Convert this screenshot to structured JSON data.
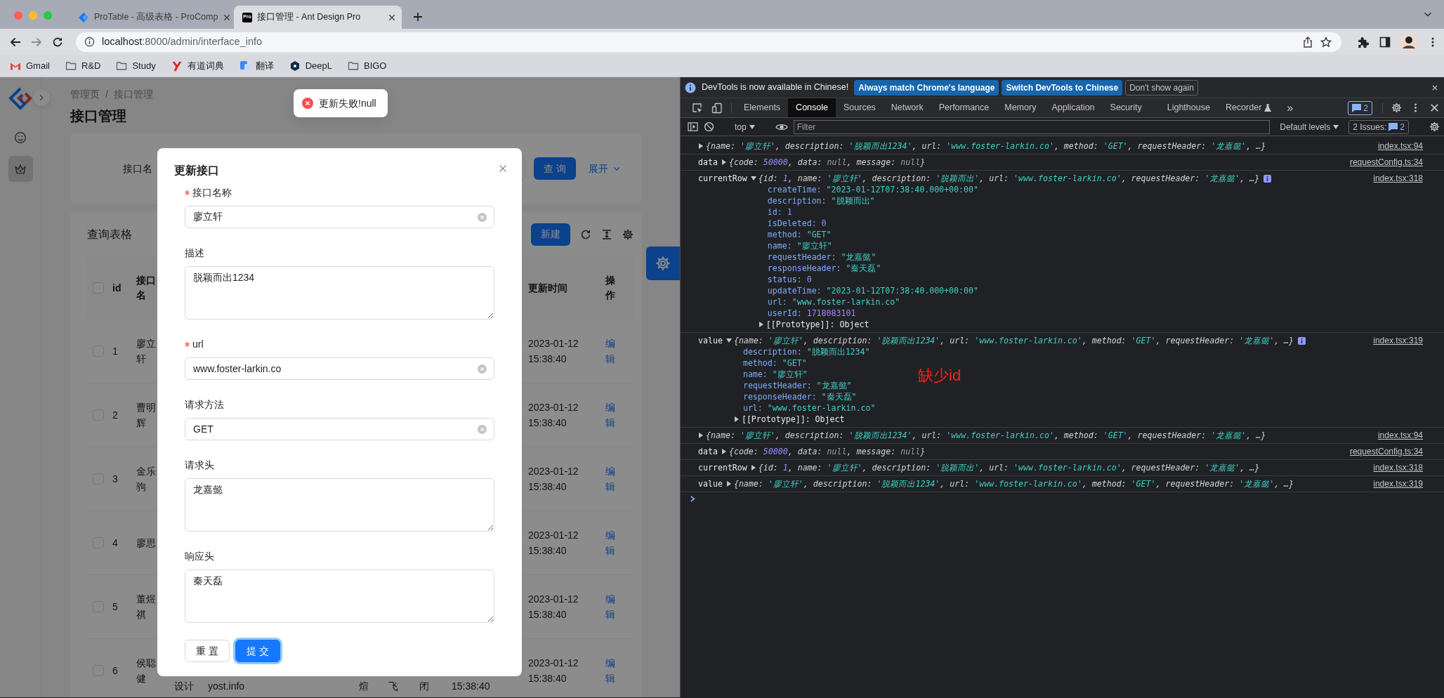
{
  "browser": {
    "tabs": [
      {
        "title": "ProTable - 高级表格 - ProComp",
        "icon": {
          "kind": "logo"
        },
        "selected": false
      },
      {
        "title": "接口管理 - Ant Design Pro",
        "icon": {
          "kind": "text",
          "text": "Pro"
        },
        "selected": true
      }
    ],
    "address": {
      "host": "localhost",
      "rest": ":8000/admin/interface_info"
    },
    "bookmarks": [
      {
        "label": "Gmail",
        "kind": "mail"
      },
      {
        "label": "R&D",
        "kind": "folder"
      },
      {
        "label": "Study",
        "kind": "folder"
      },
      {
        "label": "有道词典",
        "kind": "youdao"
      },
      {
        "label": "翻译",
        "kind": "translate"
      },
      {
        "label": "DeepL",
        "kind": "deepl"
      },
      {
        "label": "BIGO",
        "kind": "folder"
      }
    ]
  },
  "app": {
    "sidebar": {
      "items": [
        {
          "kind": "smile",
          "selected": false
        },
        {
          "kind": "crown",
          "selected": true
        }
      ]
    },
    "breadcrumb": {
      "items": [
        "管理页",
        "接口管理"
      ],
      "separator": "/"
    },
    "title": "接口管理",
    "search": {
      "label": "接口名",
      "button": "查 询",
      "expand": "展开"
    },
    "table": {
      "title": "查询表格",
      "new_button": "新建",
      "all_selected": false,
      "columns": [
        "id",
        "接口名",
        "更新时间",
        "操作"
      ],
      "rows": [
        {
          "selected": false,
          "id": "1",
          "name": "廖立轩",
          "updated": "2023-01-12 15:38:40",
          "action": "编辑"
        },
        {
          "selected": false,
          "id": "2",
          "name": "曹明辉",
          "updated": "2023-01-12 15:38:40",
          "action": "编辑"
        },
        {
          "selected": false,
          "id": "3",
          "name": "金乐驹",
          "updated": "2023-01-12 15:38:40",
          "action": "编辑"
        },
        {
          "selected": false,
          "id": "4",
          "name": "廖思",
          "updated": "2023-01-12 15:38:40",
          "action": "编辑"
        },
        {
          "selected": false,
          "id": "5",
          "name": "董煜祺",
          "updated": "2023-01-12 15:38:40",
          "action": "编辑"
        },
        {
          "selected": false,
          "id": "6",
          "name": "侯聪健",
          "updated": "2023-01-12 15:38:40",
          "action": "编辑",
          "tail": [
            "设计",
            "yost.info",
            "煊",
            "飞",
            "闭",
            "15:38:40"
          ]
        }
      ]
    },
    "toast": {
      "kind": "error",
      "text": "更新失败!null"
    },
    "modal": {
      "title": "更新接口",
      "fields": [
        {
          "label": "接口名称",
          "required": true,
          "kind": "input",
          "value": "廖立轩"
        },
        {
          "label": "描述",
          "required": false,
          "kind": "textarea",
          "value": "脱颖而出1234"
        },
        {
          "label": "url",
          "required": true,
          "kind": "input",
          "value": "www.foster-larkin.co"
        },
        {
          "label": "请求方法",
          "required": false,
          "kind": "input",
          "value": "GET"
        },
        {
          "label": "请求头",
          "required": false,
          "kind": "textarea",
          "value": "龙嘉懿"
        },
        {
          "label": "响应头",
          "required": false,
          "kind": "textarea",
          "value": "秦天磊"
        }
      ],
      "buttons": [
        {
          "label": "重 置",
          "primary": false,
          "focused": false
        },
        {
          "label": "提 交",
          "primary": true,
          "focused": true
        }
      ]
    }
  },
  "devtools": {
    "infobar": {
      "text": "DevTools is now available in Chinese!",
      "buttons": [
        {
          "label": "Always match Chrome's language",
          "primary": true
        },
        {
          "label": "Switch DevTools to Chinese",
          "primary": true
        },
        {
          "label": "Don't show again",
          "primary": false
        }
      ]
    },
    "tabs": [
      {
        "label": "Elements",
        "selected": false,
        "experimental": false
      },
      {
        "label": "Console",
        "selected": true,
        "experimental": false
      },
      {
        "label": "Sources",
        "selected": false,
        "experimental": false
      },
      {
        "label": "Network",
        "selected": false,
        "experimental": false
      },
      {
        "label": "Performance",
        "selected": false,
        "experimental": false
      },
      {
        "label": "Memory",
        "selected": false,
        "experimental": false
      },
      {
        "label": "Application",
        "selected": false,
        "experimental": false
      },
      {
        "label": "Security",
        "selected": false,
        "experimental": false
      },
      {
        "label": "Lighthouse",
        "selected": false,
        "experimental": false
      },
      {
        "label": "Recorder",
        "selected": false,
        "experimental": true
      }
    ],
    "overflow": "»",
    "messages_count": "2",
    "console_toolbar": {
      "context": "top",
      "filter_placeholder": "Filter",
      "levels": "Default levels",
      "issues_label": "2 Issues:",
      "issues_count": "2"
    },
    "entries": [
      {
        "expanded": false,
        "source": "index.tsx:94",
        "preview": [
          {
            "text": "{name: ",
            "kind": "key"
          },
          {
            "text": "'廖立轩'",
            "kind": "string"
          },
          {
            "text": ", description: ",
            "kind": "key"
          },
          {
            "text": "'脱颖而出1234'",
            "kind": "string"
          },
          {
            "text": ", url: ",
            "kind": "key"
          },
          {
            "text": "'www.foster-larkin.co'",
            "kind": "string"
          },
          {
            "text": ", method: ",
            "kind": "key"
          },
          {
            "text": "'GET'",
            "kind": "string"
          },
          {
            "text": ", requestHeader: ",
            "kind": "key"
          },
          {
            "text": "'龙嘉懿'",
            "kind": "string"
          },
          {
            "text": ", …}",
            "kind": "key"
          }
        ]
      },
      {
        "label": "data",
        "expanded": false,
        "source": "requestConfig.ts:34",
        "preview": [
          {
            "text": "{code: ",
            "kind": "key"
          },
          {
            "text": "50000",
            "kind": "number"
          },
          {
            "text": ", data: ",
            "kind": "key"
          },
          {
            "text": "null",
            "kind": "null"
          },
          {
            "text": ", message: ",
            "kind": "key"
          },
          {
            "text": "null",
            "kind": "null"
          },
          {
            "text": "}",
            "kind": "key"
          }
        ]
      },
      {
        "label": "currentRow",
        "expanded": true,
        "source": "index.tsx:318",
        "preview": [
          {
            "text": "{id: ",
            "kind": "key"
          },
          {
            "text": "1",
            "kind": "number"
          },
          {
            "text": ", name: ",
            "kind": "key"
          },
          {
            "text": "'廖立轩'",
            "kind": "string"
          },
          {
            "text": ", description: ",
            "kind": "key"
          },
          {
            "text": "'脱颖而出'",
            "kind": "string"
          },
          {
            "text": ", url: ",
            "kind": "key"
          },
          {
            "text": "'www.foster-larkin.co'",
            "kind": "string"
          },
          {
            "text": ", requestHeader: ",
            "kind": "key"
          },
          {
            "text": "'龙嘉懿'",
            "kind": "string"
          },
          {
            "text": ", …}",
            "kind": "key"
          }
        ],
        "props": [
          {
            "key": "createTime: ",
            "value": "\"2023-01-12T07:38:40.000+00:00\"",
            "kind": "string"
          },
          {
            "key": "description: ",
            "value": "\"脱颖而出\"",
            "kind": "string"
          },
          {
            "key": "id: ",
            "value": "1",
            "kind": "number"
          },
          {
            "key": "isDeleted: ",
            "value": "0",
            "kind": "number"
          },
          {
            "key": "method: ",
            "value": "\"GET\"",
            "kind": "string"
          },
          {
            "key": "name: ",
            "value": "\"廖立轩\"",
            "kind": "string"
          },
          {
            "key": "requestHeader: ",
            "value": "\"龙嘉懿\"",
            "kind": "string"
          },
          {
            "key": "responseHeader: ",
            "value": "\"秦天磊\"",
            "kind": "string"
          },
          {
            "key": "status: ",
            "value": "0",
            "kind": "number"
          },
          {
            "key": "updateTime: ",
            "value": "\"2023-01-12T07:38:40.000+00:00\"",
            "kind": "string"
          },
          {
            "key": "url: ",
            "value": "\"www.foster-larkin.co\"",
            "kind": "string"
          },
          {
            "key": "userId: ",
            "value": "1718083101",
            "kind": "number"
          },
          {
            "key": "[[Prototype]]: ",
            "value": "Object",
            "kind": "proto"
          }
        ]
      },
      {
        "label": "value",
        "expanded": true,
        "source": "index.tsx:319",
        "preview": [
          {
            "text": "{name: ",
            "kind": "key"
          },
          {
            "text": "'廖立轩'",
            "kind": "string"
          },
          {
            "text": ", description: ",
            "kind": "key"
          },
          {
            "text": "'脱颖而出1234'",
            "kind": "string"
          },
          {
            "text": ", url: ",
            "kind": "key"
          },
          {
            "text": "'www.foster-larkin.co'",
            "kind": "string"
          },
          {
            "text": ", method: ",
            "kind": "key"
          },
          {
            "text": "'GET'",
            "kind": "string"
          },
          {
            "text": ", requestHeader: ",
            "kind": "key"
          },
          {
            "text": "'龙嘉懿'",
            "kind": "string"
          },
          {
            "text": ", …}",
            "kind": "key"
          }
        ],
        "props": [
          {
            "key": "description: ",
            "value": "\"脱颖而出1234\"",
            "kind": "string"
          },
          {
            "key": "method: ",
            "value": "\"GET\"",
            "kind": "string"
          },
          {
            "key": "name: ",
            "value": "\"廖立轩\"",
            "kind": "string"
          },
          {
            "key": "requestHeader: ",
            "value": "\"龙嘉懿\"",
            "kind": "string"
          },
          {
            "key": "responseHeader: ",
            "value": "\"秦天磊\"",
            "kind": "string"
          },
          {
            "key": "url: ",
            "value": "\"www.foster-larkin.co\"",
            "kind": "string"
          },
          {
            "key": "[[Prototype]]: ",
            "value": "Object",
            "kind": "proto"
          }
        ]
      },
      {
        "expanded": false,
        "source": "index.tsx:94",
        "preview": [
          {
            "text": "{name: ",
            "kind": "key"
          },
          {
            "text": "'廖立轩'",
            "kind": "string"
          },
          {
            "text": ", description: ",
            "kind": "key"
          },
          {
            "text": "'脱颖而出1234'",
            "kind": "string"
          },
          {
            "text": ", url: ",
            "kind": "key"
          },
          {
            "text": "'www.foster-larkin.co'",
            "kind": "string"
          },
          {
            "text": ", method: ",
            "kind": "key"
          },
          {
            "text": "'GET'",
            "kind": "string"
          },
          {
            "text": ", requestHeader: ",
            "kind": "key"
          },
          {
            "text": "'龙嘉懿'",
            "kind": "string"
          },
          {
            "text": ", …}",
            "kind": "key"
          }
        ]
      },
      {
        "label": "data",
        "expanded": false,
        "source": "requestConfig.ts:34",
        "preview": [
          {
            "text": "{code: ",
            "kind": "key"
          },
          {
            "text": "50000",
            "kind": "number"
          },
          {
            "text": ", data: ",
            "kind": "key"
          },
          {
            "text": "null",
            "kind": "null"
          },
          {
            "text": ", message: ",
            "kind": "key"
          },
          {
            "text": "null",
            "kind": "null"
          },
          {
            "text": "}",
            "kind": "key"
          }
        ]
      },
      {
        "label": "currentRow",
        "expanded": false,
        "source": "index.tsx:318",
        "preview": [
          {
            "text": "{id: ",
            "kind": "key"
          },
          {
            "text": "1",
            "kind": "number"
          },
          {
            "text": ", name: ",
            "kind": "key"
          },
          {
            "text": "'廖立轩'",
            "kind": "string"
          },
          {
            "text": ", description: ",
            "kind": "key"
          },
          {
            "text": "'脱颖而出'",
            "kind": "string"
          },
          {
            "text": ", url: ",
            "kind": "key"
          },
          {
            "text": "'www.foster-larkin.co'",
            "kind": "string"
          },
          {
            "text": ", requestHeader: ",
            "kind": "key"
          },
          {
            "text": "'龙嘉懿'",
            "kind": "string"
          },
          {
            "text": ", …}",
            "kind": "key"
          }
        ]
      },
      {
        "label": "value",
        "expanded": false,
        "source": "index.tsx:319",
        "preview": [
          {
            "text": "{name: ",
            "kind": "key"
          },
          {
            "text": "'廖立轩'",
            "kind": "string"
          },
          {
            "text": ", description: ",
            "kind": "key"
          },
          {
            "text": "'脱颖而出1234'",
            "kind": "string"
          },
          {
            "text": ", url: ",
            "kind": "key"
          },
          {
            "text": "'www.foster-larkin.co'",
            "kind": "string"
          },
          {
            "text": ", method: ",
            "kind": "key"
          },
          {
            "text": "'GET'",
            "kind": "string"
          },
          {
            "text": ", requestHeader: ",
            "kind": "key"
          },
          {
            "text": "'龙嘉懿'",
            "kind": "string"
          },
          {
            "text": ", …}",
            "kind": "key"
          }
        ]
      }
    ],
    "annotation": "缺少id"
  }
}
